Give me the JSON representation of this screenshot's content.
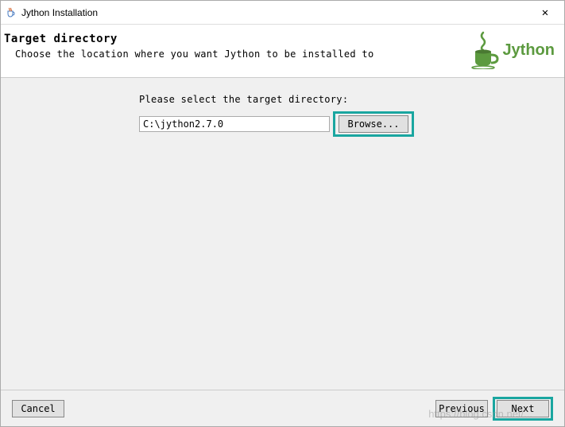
{
  "titlebar": {
    "title": "Jython Installation",
    "close_symbol": "✕"
  },
  "header": {
    "title": "Target directory",
    "subtitle": "Choose the location where you want Jython to be installed to",
    "logo_text": "Jython"
  },
  "form": {
    "label": "Please select the target directory:",
    "path_value": "C:\\jython2.7.0",
    "browse_label": "Browse..."
  },
  "footer": {
    "cancel_label": "Cancel",
    "previous_label": "Previous",
    "next_label": "Next"
  },
  "watermark": "https://blog.csdn.net/..."
}
